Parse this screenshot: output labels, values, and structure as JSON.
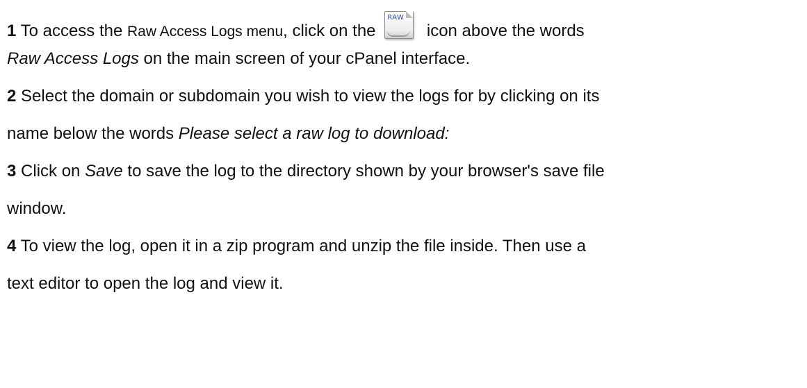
{
  "steps": [
    {
      "number": "1",
      "text_a": " To access the ",
      "text_b": "Raw Access Logs menu",
      "text_c": ", click on the ",
      "icon": {
        "name": "raw-icon",
        "label": "RAW"
      },
      "text_d": " icon above the words",
      "text_e": "Raw Access Logs",
      "text_f": " on the main screen of your cPanel interface."
    },
    {
      "number": "2",
      "text_a": " Select the domain or subdomain you wish to view the logs for by clicking on its",
      "text_b": "name below the words ",
      "text_c": "Please select a raw log to download:"
    },
    {
      "number": "3",
      "text_a": " Click on ",
      "text_b": "Save",
      "text_c": " to save the log to the directory shown by your browser's save file",
      "text_d": "window."
    },
    {
      "number": "4",
      "text_a": " To view the log, open it in a zip program and unzip the file inside. Then use a",
      "text_b": "text editor to open the log and view it."
    }
  ]
}
